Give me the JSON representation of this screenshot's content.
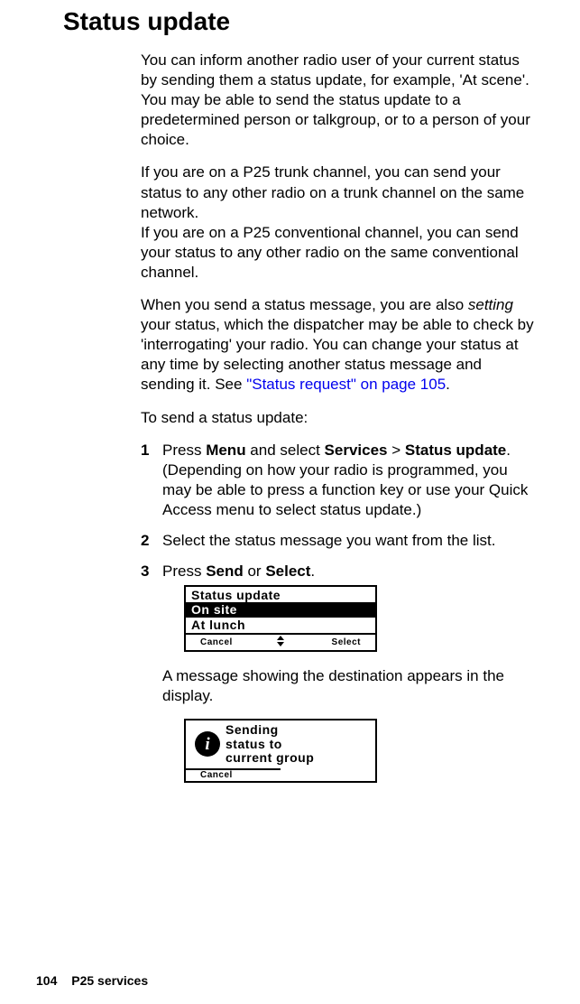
{
  "title": "Status update",
  "paragraphs": {
    "p1": "You can inform another radio user of your current status by sending them a status update, for example, 'At scene'. You may be able to send the status update to a predetermined person or talkgroup, or to a person of your choice.",
    "p2": "If you are on a P25 trunk channel, you can send your status to any other radio on a trunk channel on the same network.",
    "p2b": "If you are on a P25 conventional channel, you can send your status to any other radio on the same conventional channel.",
    "p3_prefix": "When you send a status message, you are also ",
    "p3_setting": "setting",
    "p3_mid": " your status, which the dispatcher may be able to check by 'interrogating' your radio. You can change your status at any time by selecting another status message and sending it. See ",
    "p3_link": "\"Status request\" on page 105",
    "p3_suffix": ".",
    "p4": "To send a status update:"
  },
  "steps": {
    "s1_num": "1",
    "s1_a": "Press ",
    "s1_menu": "Menu",
    "s1_b": " and select ",
    "s1_services": "Services",
    "s1_c": " > ",
    "s1_status_update": "Status update",
    "s1_d": ". (Depending on how your radio is programmed, you may be able to press a function key or use your Quick Access menu to select status update.)",
    "s2_num": "2",
    "s2": "Select the status message you want from the list.",
    "s3_num": "3",
    "s3_a": "Press ",
    "s3_send": "Send",
    "s3_b": " or ",
    "s3_select": "Select",
    "s3_c": "."
  },
  "display1": {
    "title": "Status update",
    "row_selected": "On site",
    "row2": "At lunch",
    "soft_left": "Cancel",
    "soft_right": "Select"
  },
  "after_display1": "A message showing the destination appears in the display.",
  "display2": {
    "line1": "Sending",
    "line2": "status to",
    "line3": "current group",
    "soft_left": "Cancel"
  },
  "footer": {
    "page": "104",
    "section": "P25 services"
  }
}
